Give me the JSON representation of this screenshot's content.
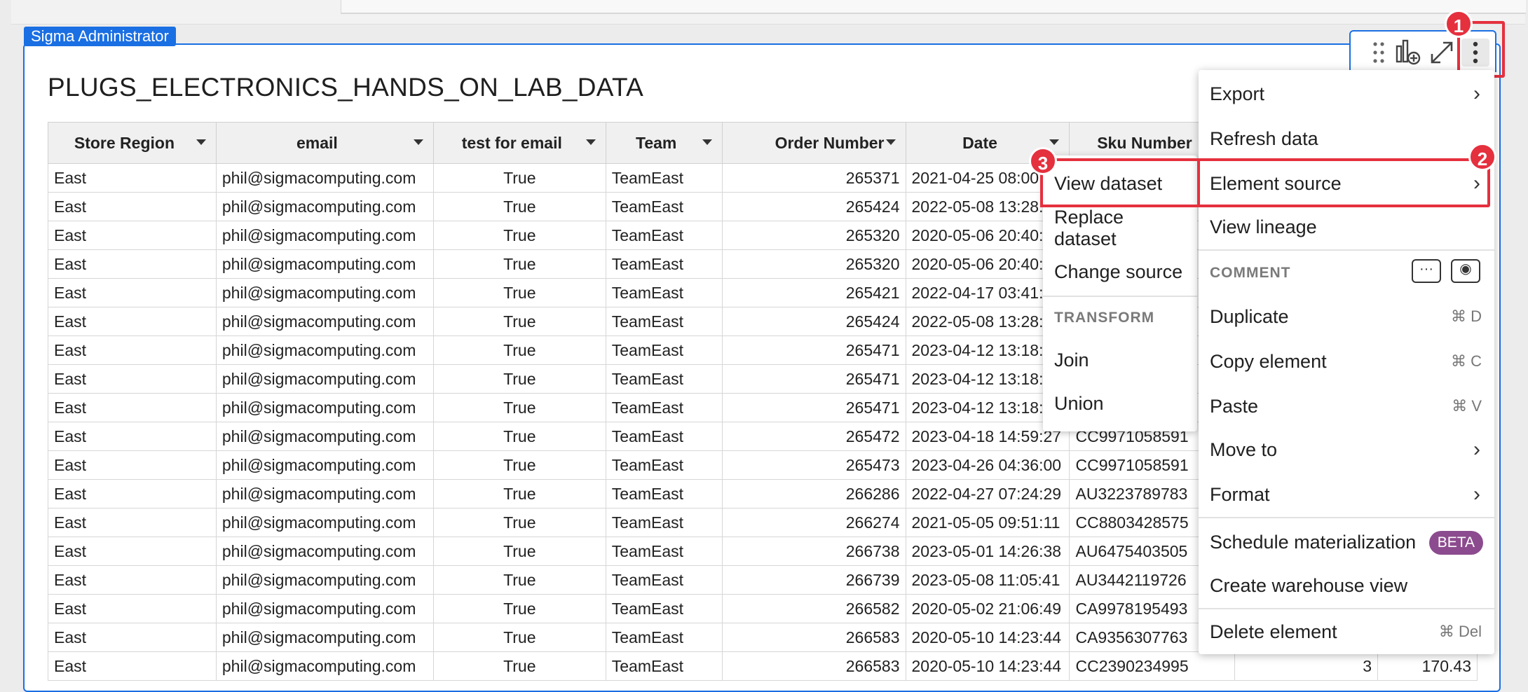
{
  "owner_badge": "Sigma Administrator",
  "title": "PLUGS_ELECTRONICS_HANDS_ON_LAB_DATA",
  "columns": [
    "Store Region",
    "email",
    "test for email",
    "Team",
    "Order Number",
    "Date",
    "Sku Number",
    "",
    ""
  ],
  "rows": [
    [
      "East",
      "phil@sigmacomputing.com",
      "True",
      "TeamEast",
      "265371",
      "2021-04-25 08:00:",
      "",
      "",
      ""
    ],
    [
      "East",
      "phil@sigmacomputing.com",
      "True",
      "TeamEast",
      "265424",
      "2022-05-08 13:28:",
      "",
      "",
      ""
    ],
    [
      "East",
      "phil@sigmacomputing.com",
      "True",
      "TeamEast",
      "265320",
      "2020-05-06 20:40:",
      "",
      "",
      ""
    ],
    [
      "East",
      "phil@sigmacomputing.com",
      "True",
      "TeamEast",
      "265320",
      "2020-05-06 20:40:",
      "",
      "",
      ""
    ],
    [
      "East",
      "phil@sigmacomputing.com",
      "True",
      "TeamEast",
      "265421",
      "2022-04-17 03:41:",
      "",
      "",
      ""
    ],
    [
      "East",
      "phil@sigmacomputing.com",
      "True",
      "TeamEast",
      "265424",
      "2022-05-08 13:28:",
      "",
      "",
      ""
    ],
    [
      "East",
      "phil@sigmacomputing.com",
      "True",
      "TeamEast",
      "265471",
      "2023-04-12 13:18:",
      "",
      "",
      ""
    ],
    [
      "East",
      "phil@sigmacomputing.com",
      "True",
      "TeamEast",
      "265471",
      "2023-04-12 13:18:",
      "",
      "",
      ""
    ],
    [
      "East",
      "phil@sigmacomputing.com",
      "True",
      "TeamEast",
      "265471",
      "2023-04-12 13:18:",
      "",
      "",
      ""
    ],
    [
      "East",
      "phil@sigmacomputing.com",
      "True",
      "TeamEast",
      "265472",
      "2023-04-18 14:59:27",
      "CC9971058591",
      "",
      ""
    ],
    [
      "East",
      "phil@sigmacomputing.com",
      "True",
      "TeamEast",
      "265473",
      "2023-04-26 04:36:00",
      "CC9971058591",
      "",
      ""
    ],
    [
      "East",
      "phil@sigmacomputing.com",
      "True",
      "TeamEast",
      "266286",
      "2022-04-27 07:24:29",
      "AU3223789783",
      "",
      ""
    ],
    [
      "East",
      "phil@sigmacomputing.com",
      "True",
      "TeamEast",
      "266274",
      "2021-05-05 09:51:11",
      "CC8803428575",
      "",
      ""
    ],
    [
      "East",
      "phil@sigmacomputing.com",
      "True",
      "TeamEast",
      "266738",
      "2023-05-01 14:26:38",
      "AU6475403505",
      "",
      ""
    ],
    [
      "East",
      "phil@sigmacomputing.com",
      "True",
      "TeamEast",
      "266739",
      "2023-05-08 11:05:41",
      "AU3442119726",
      "",
      ""
    ],
    [
      "East",
      "phil@sigmacomputing.com",
      "True",
      "TeamEast",
      "266582",
      "2020-05-02 21:06:49",
      "CA9978195493",
      "",
      ""
    ],
    [
      "East",
      "phil@sigmacomputing.com",
      "True",
      "TeamEast",
      "266583",
      "2020-05-10 14:23:44",
      "CA9356307763",
      "",
      ""
    ],
    [
      "East",
      "phil@sigmacomputing.com",
      "True",
      "TeamEast",
      "266583",
      "2020-05-10 14:23:44",
      "CC2390234995",
      "3",
      "170.43"
    ]
  ],
  "submenu": {
    "view_dataset": "View dataset",
    "replace_dataset": "Replace dataset",
    "change_source": "Change source",
    "transform_header": "TRANSFORM",
    "join": "Join",
    "union": "Union"
  },
  "menu": {
    "export": "Export",
    "refresh": "Refresh data",
    "element_source": "Element source",
    "view_lineage": "View lineage",
    "comment_header": "COMMENT",
    "duplicate": "Duplicate",
    "duplicate_sc": "⌘ D",
    "copy": "Copy element",
    "copy_sc": "⌘ C",
    "paste": "Paste",
    "paste_sc": "⌘ V",
    "move_to": "Move to",
    "format": "Format",
    "schedule": "Schedule materialization",
    "beta": "BETA",
    "create_view": "Create warehouse view",
    "delete": "Delete element",
    "delete_sc": "⌘ Del"
  },
  "callouts": {
    "one": "1",
    "two": "2",
    "three": "3"
  },
  "icons": {
    "drag": "drag-handle-icon",
    "chart": "add-chart-icon",
    "expand": "expand-icon",
    "more": "more-vertical-icon",
    "comment": "comment-icon",
    "screenshot": "screenshot-comment-icon",
    "chevron": "chevron-right-icon"
  },
  "colors": {
    "accent": "#1a6fe3",
    "highlight": "#e5303e",
    "beta": "#8c4b8e"
  }
}
